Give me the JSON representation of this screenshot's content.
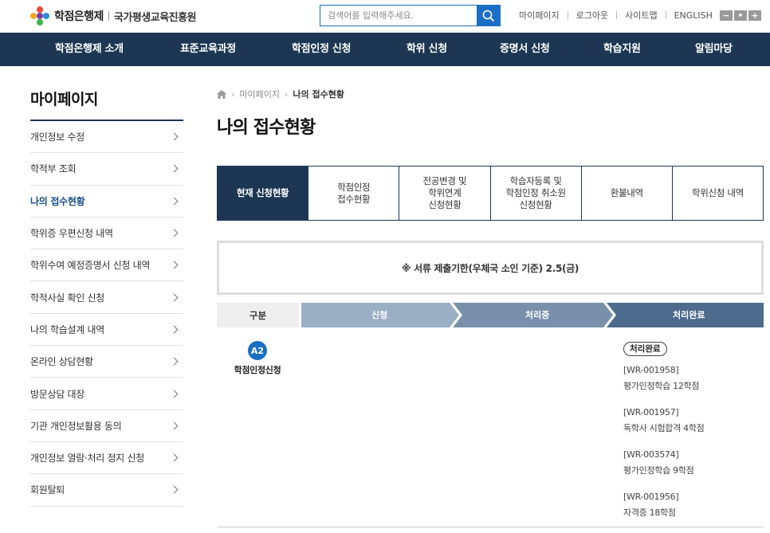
{
  "header": {
    "logo_title": "학점은행제",
    "logo_sub": "국가평생교육진흥원",
    "search_placeholder": "검색어를 입력해주세요.",
    "util_links": [
      "마이페이지",
      "로그아웃",
      "사이트맵",
      "ENGLISH"
    ],
    "zoom": [
      "−",
      "•",
      "+"
    ]
  },
  "gnb": [
    "학점은행제 소개",
    "표준교육과정",
    "학점인정 신청",
    "학위 신청",
    "증명서 신청",
    "학습지원",
    "알림마당"
  ],
  "sidebar": {
    "title": "마이페이지",
    "items": [
      {
        "label": "개인정보 수정",
        "active": false
      },
      {
        "label": "학적부 조회",
        "active": false
      },
      {
        "label": "나의 접수현황",
        "active": true
      },
      {
        "label": "학위증 우편신청 내역",
        "active": false
      },
      {
        "label": "학위수여 예정증명서 신청 내역",
        "active": false
      },
      {
        "label": "학적사실 확인 신청",
        "active": false
      },
      {
        "label": "나의 학습설계 내역",
        "active": false
      },
      {
        "label": "온라인 상담현황",
        "active": false
      },
      {
        "label": "방문상담 대장",
        "active": false
      },
      {
        "label": "기관 개인정보활용 동의",
        "active": false
      },
      {
        "label": "개인정보 열람·처리 정지 신청",
        "active": false
      },
      {
        "label": "회원탈퇴",
        "active": false
      }
    ]
  },
  "breadcrumb": {
    "parent": "마이페이지",
    "current": "나의 접수현황"
  },
  "page_title": "나의 접수현황",
  "tabs": [
    {
      "label": "현재 신청현황",
      "active": true
    },
    {
      "label": "학점인정\n접수현황",
      "active": false
    },
    {
      "label": "전공변경 및\n학위연계\n신청현황",
      "active": false
    },
    {
      "label": "학습자등록 및\n학점인정 취소원\n신청현황",
      "active": false
    },
    {
      "label": "환불내역",
      "active": false
    },
    {
      "label": "학위신청 내역",
      "active": false
    }
  ],
  "notice": "※ 서류 제출기한(우체국 소인 기준) 2.5(금)",
  "process": {
    "gubun": "구분",
    "steps": [
      "신청",
      "처리중",
      "처리완료"
    ],
    "colors": [
      "#9aaec4",
      "#7890ab",
      "#4d6b8d"
    ]
  },
  "row": {
    "badge": "A2",
    "label": "학점인정신청",
    "status": "처리완료",
    "records": [
      {
        "code": "[WR-001958]",
        "desc": "평가인정학습 12학점"
      },
      {
        "code": "[WR-001957]",
        "desc": "독학사 시험합격 4학점"
      },
      {
        "code": "[WR-003574]",
        "desc": "평가인정학습 9학점"
      },
      {
        "code": "[WR-001956]",
        "desc": "자격증 18학점"
      }
    ]
  }
}
